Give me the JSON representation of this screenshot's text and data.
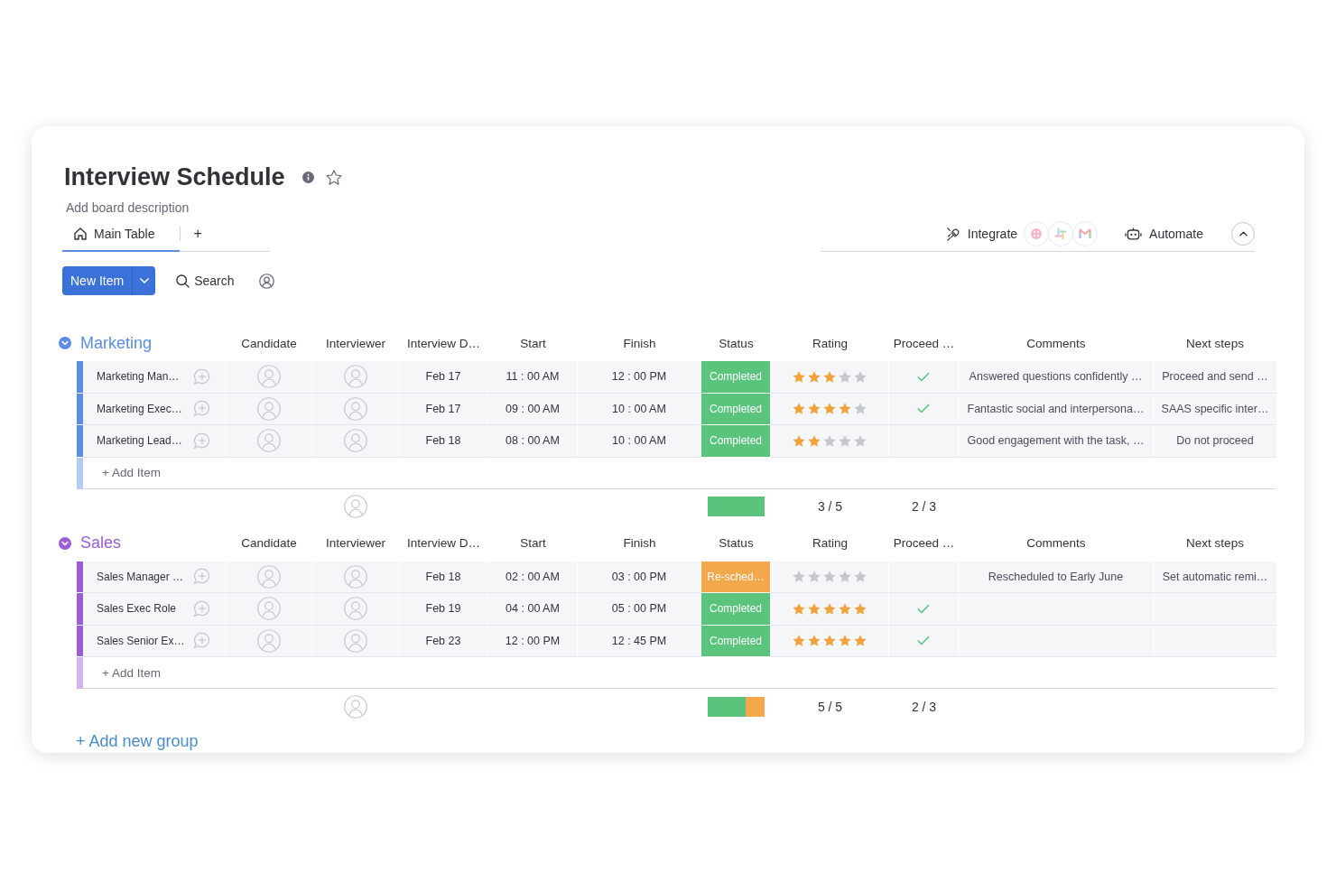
{
  "board": {
    "title": "Interview Schedule",
    "description": "Add board description"
  },
  "views": {
    "tabs": [
      {
        "label": "Main Table",
        "selected": true
      }
    ],
    "add_view": "+"
  },
  "board_actions": {
    "integrate": "Integrate",
    "automate": "Automate"
  },
  "toolbar": {
    "new_item": "New Item",
    "search": "Search"
  },
  "groups": [
    {
      "title": "Marketing",
      "color": "#5a8de3",
      "columns": [
        "Candidate",
        "Interviewer",
        "Interview D…",
        "Start",
        "Finish",
        "Status",
        "Rating",
        "Proceed …",
        "Comments",
        "Next steps"
      ],
      "rows": [
        {
          "name": "Marketing Man…",
          "date": "Feb 17",
          "start": "11 : 00 AM",
          "finish": "12 : 00 PM",
          "status": {
            "label": "Completed",
            "color": "#5ac47d"
          },
          "stars": 3,
          "proceed": true,
          "comments": "Answered questions confidently …",
          "next_steps": "Proceed and send …"
        },
        {
          "name": "Marketing Exec…",
          "date": "Feb 17",
          "start": "09 : 00 AM",
          "finish": "10 : 00 AM",
          "status": {
            "label": "Completed",
            "color": "#5ac47d"
          },
          "stars": 4,
          "proceed": true,
          "comments": "Fantastic social and interpersona…",
          "next_steps": "SAAS specific inter…"
        },
        {
          "name": "Marketing Lead…",
          "date": "Feb 18",
          "start": "08 : 00 AM",
          "finish": "10 : 00 AM",
          "status": {
            "label": "Completed",
            "color": "#5ac47d"
          },
          "stars": 2,
          "proceed": false,
          "comments": "Good engagement with the task, …",
          "next_steps": "Do not proceed"
        }
      ],
      "add_item": {
        "placeholder": "+ Add Item"
      },
      "summary": {
        "rating": "3 / 5",
        "proceed": "2 / 3"
      }
    },
    {
      "title": "Sales",
      "color": "#9b5cd6",
      "columns": [
        "Candidate",
        "Interviewer",
        "Interview D…",
        "Start",
        "Finish",
        "Status",
        "Rating",
        "Proceed …",
        "Comments",
        "Next steps"
      ],
      "rows": [
        {
          "name": "Sales Manager …",
          "date": "Feb 18",
          "start": "02 : 00 AM",
          "finish": "03 : 00 PM",
          "status": {
            "label": "Re-sched…",
            "color": "#f2a84b"
          },
          "stars": 0,
          "proceed": false,
          "comments": "Rescheduled to Early June",
          "next_steps": "Set automatic remi…"
        },
        {
          "name": "Sales Exec Role",
          "date": "Feb 19",
          "start": "04 : 00 AM",
          "finish": "05 : 00 PM",
          "status": {
            "label": "Completed",
            "color": "#5ac47d"
          },
          "stars": 5,
          "proceed": true
        },
        {
          "name": "Sales Senior Ex…",
          "date": "Feb 23",
          "start": "12 : 00 PM",
          "finish": "12 : 45 PM",
          "status": {
            "label": "Completed",
            "color": "#5ac47d"
          },
          "stars": 5,
          "proceed": true
        }
      ],
      "add_item": {
        "placeholder": "+ Add Item"
      },
      "summary": {
        "rating": "5 / 5",
        "proceed": "2 / 3"
      }
    }
  ],
  "add_group": "+ Add new group"
}
